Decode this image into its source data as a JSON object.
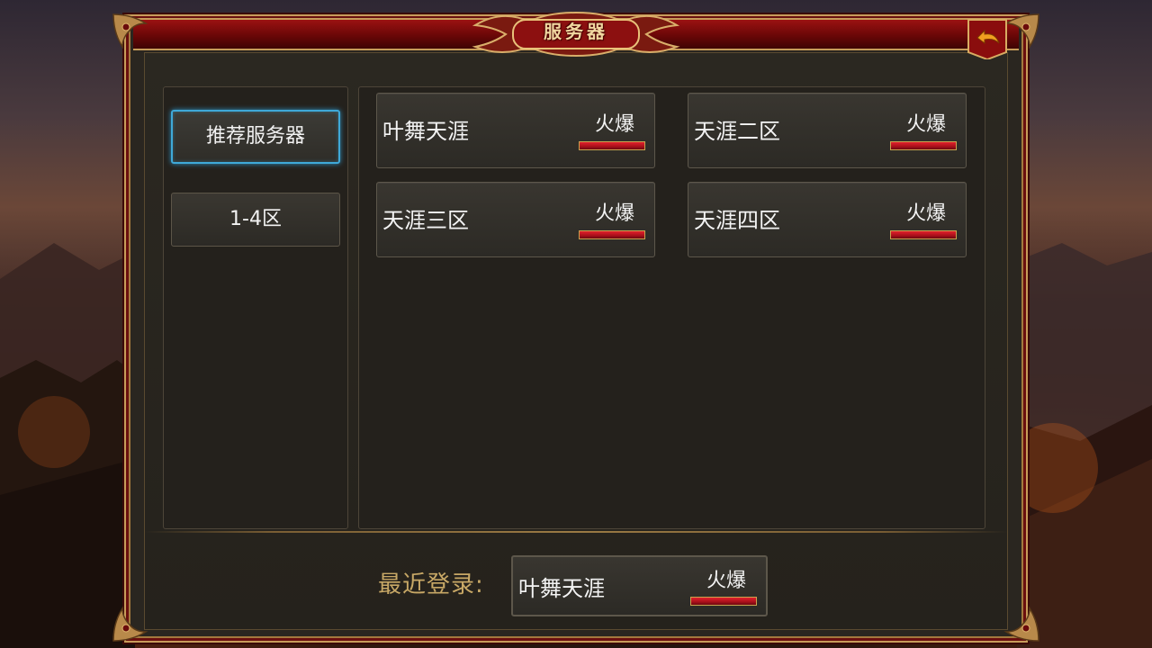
{
  "header": {
    "title": "服务器"
  },
  "sidebar": {
    "items": [
      {
        "label": "推荐服务器",
        "active": true
      },
      {
        "label": "1-4区",
        "active": false
      }
    ]
  },
  "servers": [
    {
      "name": "叶舞天涯",
      "status": "火爆"
    },
    {
      "name": "天涯二区",
      "status": "火爆"
    },
    {
      "name": "天涯三区",
      "status": "火爆"
    },
    {
      "name": "天涯四区",
      "status": "火爆"
    }
  ],
  "recent": {
    "label": "最近登录:",
    "server": {
      "name": "叶舞天涯",
      "status": "火爆"
    }
  },
  "colors": {
    "accent_blue": "#3fa9d8",
    "frame_red": "#6a0707",
    "gold": "#c79c5a",
    "status_hot": "#d01824"
  },
  "icons": {
    "back": "back-arrow-icon"
  }
}
